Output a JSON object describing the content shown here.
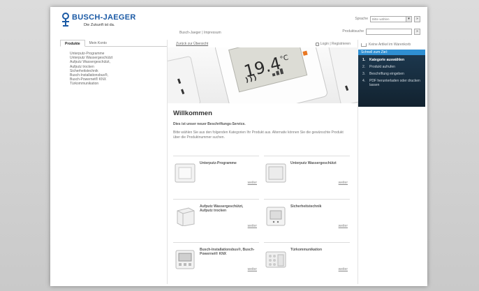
{
  "brand": {
    "name": "BUSCH-JAEGER",
    "tagline": "Die Zukunft ist da.",
    "color": "#1b5aa5"
  },
  "header": {
    "top_links": [
      "Busch-Jaeger",
      "Impressum"
    ],
    "language_label": "Sprache",
    "language_select": "Bitte wählen",
    "product_search_label": "Produktsuche",
    "product_search_value": ""
  },
  "left": {
    "tabs": [
      "Produkte",
      "Mein Konto"
    ],
    "active_tab": "Produkte",
    "categories": [
      "Unterputz-Programme",
      "Unterputz Wassergeschützt",
      "Aufputz Wassergeschützt,",
      "Aufputz trocken",
      "Sicherheitstechnik",
      "Busch-Installationsbus®,",
      "Busch-Powernet® KNX",
      "Türkommunikation"
    ]
  },
  "center": {
    "back_link": "Zurück zur Übersicht",
    "login_link": "Login | Registrieren",
    "hero": {
      "display_value": "19.4",
      "display_unit": "°C"
    },
    "title": "Willkommen",
    "subtitle": "Dies ist unser neuer Beschriftungs-Service.",
    "intro": "Bitte wählen Sie aus den folgenden Kategorien Ihr Produkt aus. Alternativ können Sie die gewünschte Produkt über die Produktnummer suchen.",
    "tiles": [
      {
        "name": "Unterputz-Programme",
        "more": "weiter"
      },
      {
        "name": "Unterputz Wassergeschützt",
        "more": "weiter"
      },
      {
        "name": "Aufputz Wassergeschützt, Aufputz trocken",
        "more": "weiter"
      },
      {
        "name": "Sicherheitstechnik",
        "more": "weiter"
      },
      {
        "name": "Busch-Installationsbus®, Busch-Powernet® KNX",
        "more": "weiter"
      },
      {
        "name": "Türkommunikation",
        "more": "weiter"
      }
    ]
  },
  "right": {
    "cart_text": "Keine Artikel im Warenkorb",
    "steps_header": "Schnell zum Ziel:",
    "steps": [
      {
        "num": "1.",
        "label": "Kategorie auswählen",
        "active": true
      },
      {
        "num": "2.",
        "label": "Produkt aufrufen",
        "active": false
      },
      {
        "num": "3.",
        "label": "Beschriftung eingeben",
        "active": false
      },
      {
        "num": "4.",
        "label": "PDF herunterladen oder drucken lassen",
        "active": false
      }
    ],
    "accent_color": "#2f8fd2",
    "panel_color": "#1d3950"
  }
}
